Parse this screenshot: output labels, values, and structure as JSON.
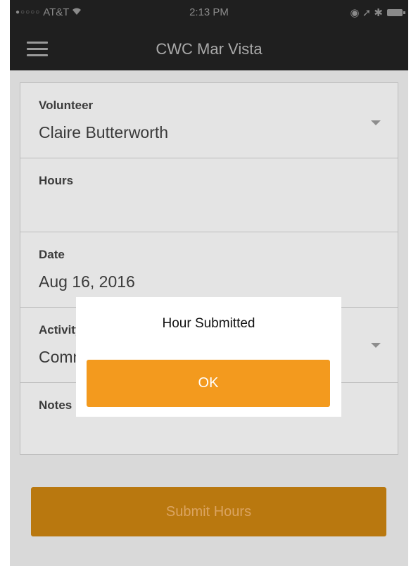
{
  "status_bar": {
    "carrier": "AT&T",
    "signal": "●○○○○",
    "time": "2:13 PM",
    "right_icons": "◉ ➚ ✱"
  },
  "nav": {
    "title": "CWC Mar Vista",
    "menu_icon": "hamburger-icon"
  },
  "form": {
    "volunteer": {
      "label": "Volunteer",
      "value": "Claire Butterworth"
    },
    "hours": {
      "label": "Hours",
      "value": ""
    },
    "date": {
      "label": "Date",
      "value": "Aug 16, 2016"
    },
    "activity": {
      "label": "Activity",
      "value": "Committee Work - General"
    },
    "notes": {
      "label": "Notes",
      "value": ""
    },
    "submit_label": "Submit Hours"
  },
  "dialog": {
    "title": "Hour Submitted",
    "ok_label": "OK"
  },
  "colors": {
    "accent": "#f39a1e",
    "dimmed_accent": "#b9780f",
    "navbar": "#1f1f1f"
  }
}
